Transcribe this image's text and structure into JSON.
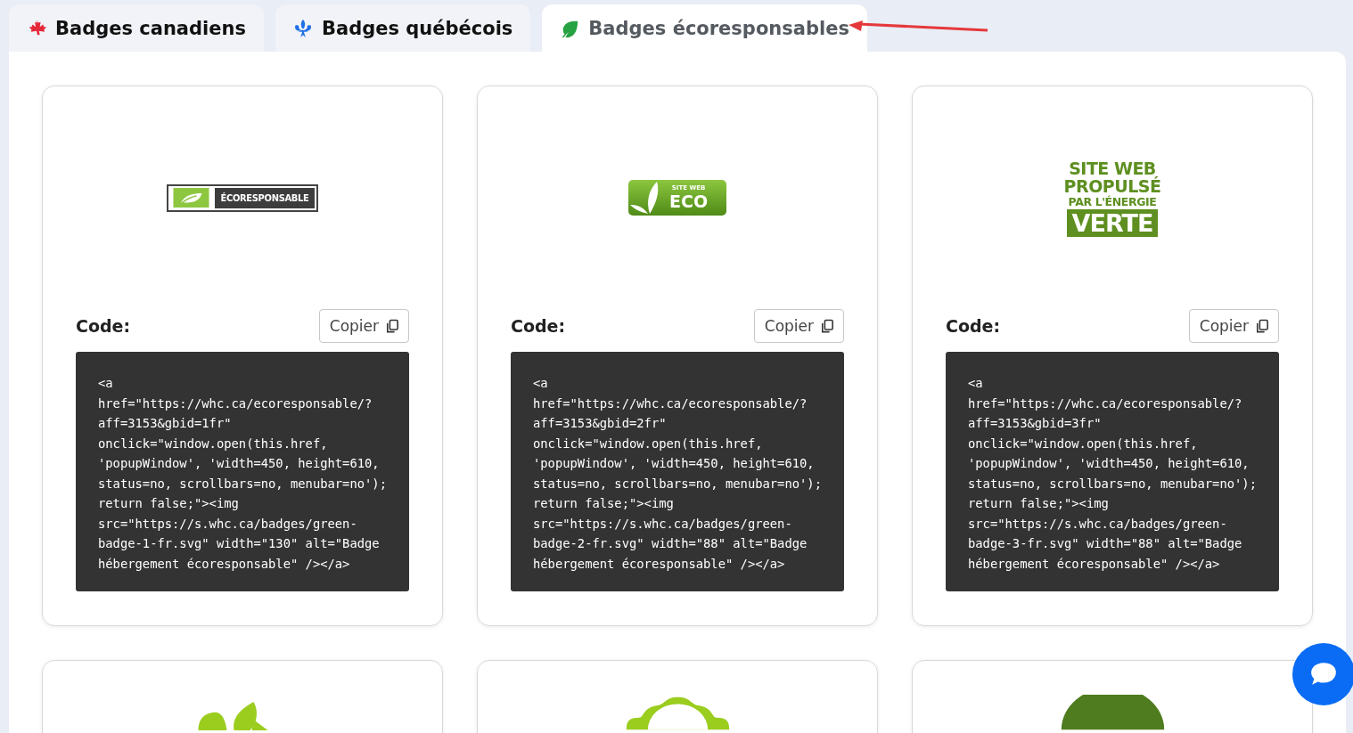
{
  "tabs": [
    {
      "label": "Badges canadiens",
      "kind": "maple",
      "selected": false
    },
    {
      "label": "Badges québécois",
      "kind": "fleur",
      "selected": false
    },
    {
      "label": "Badges écoresponsables",
      "kind": "leaf",
      "selected": true
    }
  ],
  "cards": [
    {
      "badge": {
        "kind": "bar",
        "lines": [
          "ÉCORESPONSABLE"
        ]
      },
      "code_label": "Code:",
      "copy_button": "Copier",
      "code": [
        "<a",
        "href=\"https://whc.ca/ecoresponsable/?",
        "aff=3153&gbid=1fr\"",
        "onclick=\"window.open(this.href,",
        "'popupWindow', 'width=450, height=610,",
        "status=no, scrollbars=no, menubar=no');",
        "return false;\"><img",
        "src=\"https://s.whc.ca/badges/green-",
        "badge-1-fr.svg\" width=\"130\" alt=\"Badge",
        "hébergement écoresponsable\" /></a>"
      ]
    },
    {
      "badge": {
        "kind": "tag",
        "lines": [
          "SITE WEB",
          "ECO"
        ]
      },
      "code_label": "Code:",
      "copy_button": "Copier",
      "code": [
        "<a",
        "href=\"https://whc.ca/ecoresponsable/?",
        "aff=3153&gbid=2fr\"",
        "onclick=\"window.open(this.href,",
        "'popupWindow', 'width=450, height=610,",
        "status=no, scrollbars=no, menubar=no');",
        "return false;\"><img",
        "src=\"https://s.whc.ca/badges/green-",
        "badge-2-fr.svg\" width=\"88\" alt=\"Badge",
        "hébergement écoresponsable\" /></a>"
      ]
    },
    {
      "badge": {
        "kind": "stack",
        "lines": [
          "SITE WEB",
          "PROPULSÉ",
          "PAR L'ÉNERGIE",
          "VERTE"
        ]
      },
      "code_label": "Code:",
      "copy_button": "Copier",
      "code": [
        "<a",
        "href=\"https://whc.ca/ecoresponsable/?",
        "aff=3153&gbid=3fr\"",
        "onclick=\"window.open(this.href,",
        "'popupWindow', 'width=450, height=610,",
        "status=no, scrollbars=no, menubar=no');",
        "return false;\"><img",
        "src=\"https://s.whc.ca/badges/green-",
        "badge-3-fr.svg\" width=\"88\" alt=\"Badge",
        "hébergement écoresponsable\" /></a>"
      ]
    }
  ],
  "more_cards": [
    {
      "kind": "leaves"
    },
    {
      "kind": "seal"
    },
    {
      "kind": "circle"
    }
  ]
}
